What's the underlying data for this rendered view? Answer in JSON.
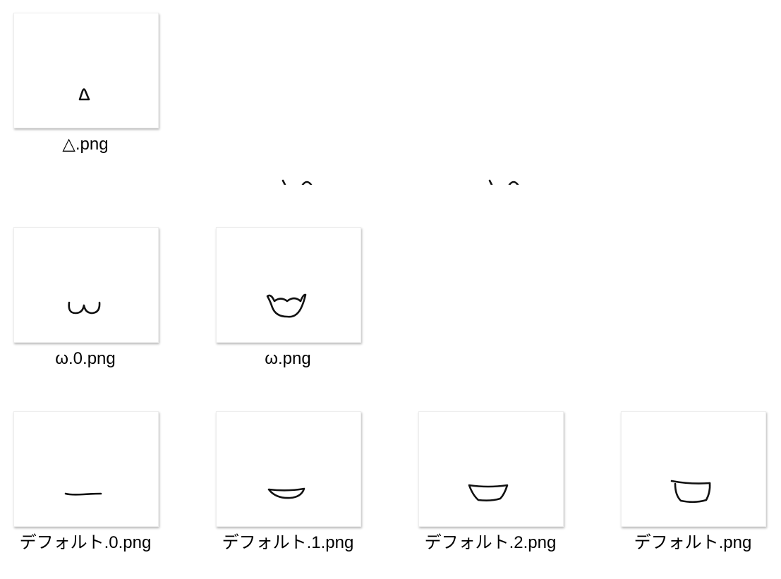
{
  "files": [
    {
      "name": "△.png",
      "icon": "triangle-mouth-thumbnail"
    },
    {
      "name": "ω.0.png",
      "icon": "omega-mouth-thumbnail"
    },
    {
      "name": "ω.png",
      "icon": "omega-open-mouth-thumbnail"
    },
    {
      "name": "デフォルト.0.png",
      "icon": "default-mouth-line-thumbnail"
    },
    {
      "name": "デフォルト.1.png",
      "icon": "default-mouth-small-thumbnail"
    },
    {
      "name": "デフォルト.2.png",
      "icon": "default-mouth-medium-thumbnail"
    },
    {
      "name": "デフォルト.png",
      "icon": "default-mouth-open-thumbnail"
    }
  ]
}
